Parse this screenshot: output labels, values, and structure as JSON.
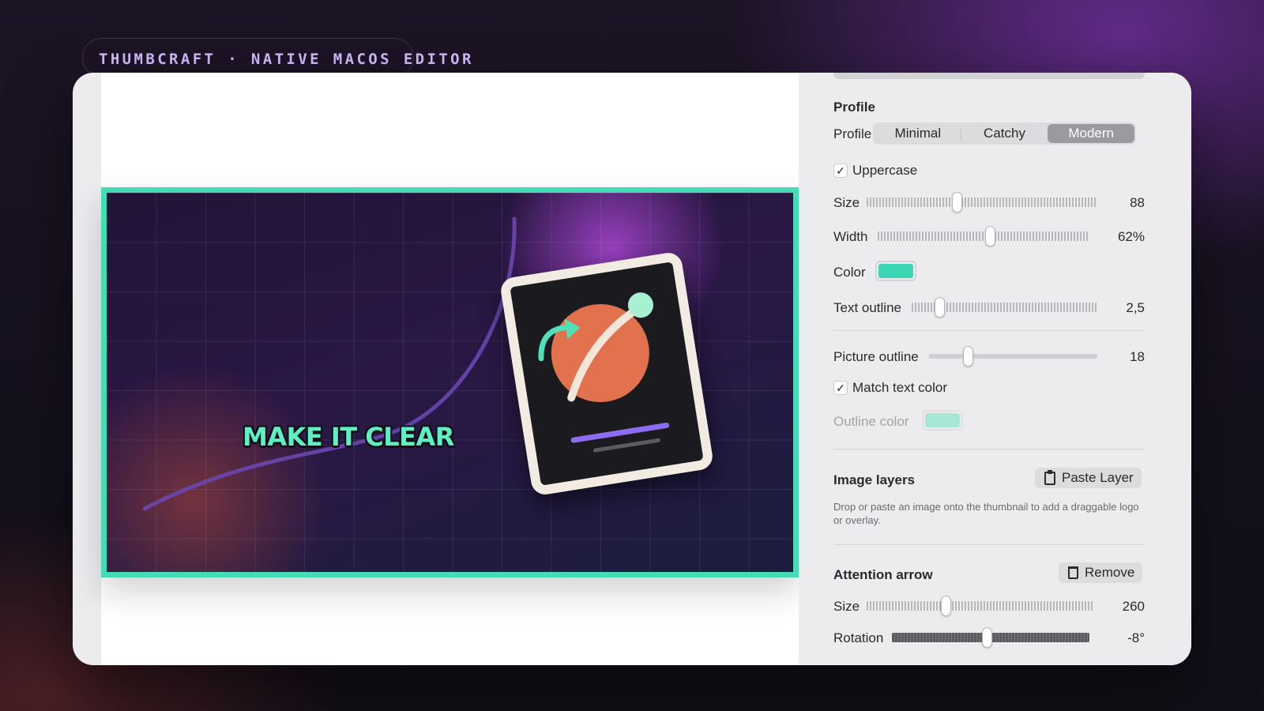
{
  "header": {
    "label": "THUMBCRAFT · NATIVE MACOS EDITOR"
  },
  "thumbnail": {
    "text": "MAKE IT CLEAR",
    "border_color": "#45dbb5"
  },
  "profile": {
    "section_title": "Profile",
    "label": "Profile",
    "options": [
      "Minimal",
      "Catchy",
      "Modern"
    ],
    "selected": "Modern"
  },
  "uppercase": {
    "label": "Uppercase",
    "checked": true
  },
  "size": {
    "label": "Size",
    "value": "88",
    "fraction": 0.39
  },
  "width": {
    "label": "Width",
    "value": "62%",
    "fraction": 0.53
  },
  "color": {
    "label": "Color",
    "value": "#3dd6b4"
  },
  "text_outline": {
    "label": "Text outline",
    "value": "2,5",
    "fraction": 0.15
  },
  "picture_outline": {
    "label": "Picture outline",
    "value": "18",
    "fraction": 0.23
  },
  "match_text_color": {
    "label": "Match text color",
    "checked": true
  },
  "outline_color": {
    "label": "Outline color",
    "value": "#a6e8d5"
  },
  "image_layers": {
    "title": "Image layers",
    "button": "Paste Layer",
    "hint": "Drop or paste an image onto the thumbnail to add a draggable logo or overlay."
  },
  "attention_arrow": {
    "title": "Attention arrow",
    "button": "Remove",
    "size_label": "Size",
    "size_value": "260",
    "size_fraction": 0.35,
    "rotation_label": "Rotation",
    "rotation_value": "-8°",
    "rotation_fraction": 0.48
  },
  "icons": [
    "checkmark-icon",
    "clipboard-icon",
    "trash-icon"
  ]
}
